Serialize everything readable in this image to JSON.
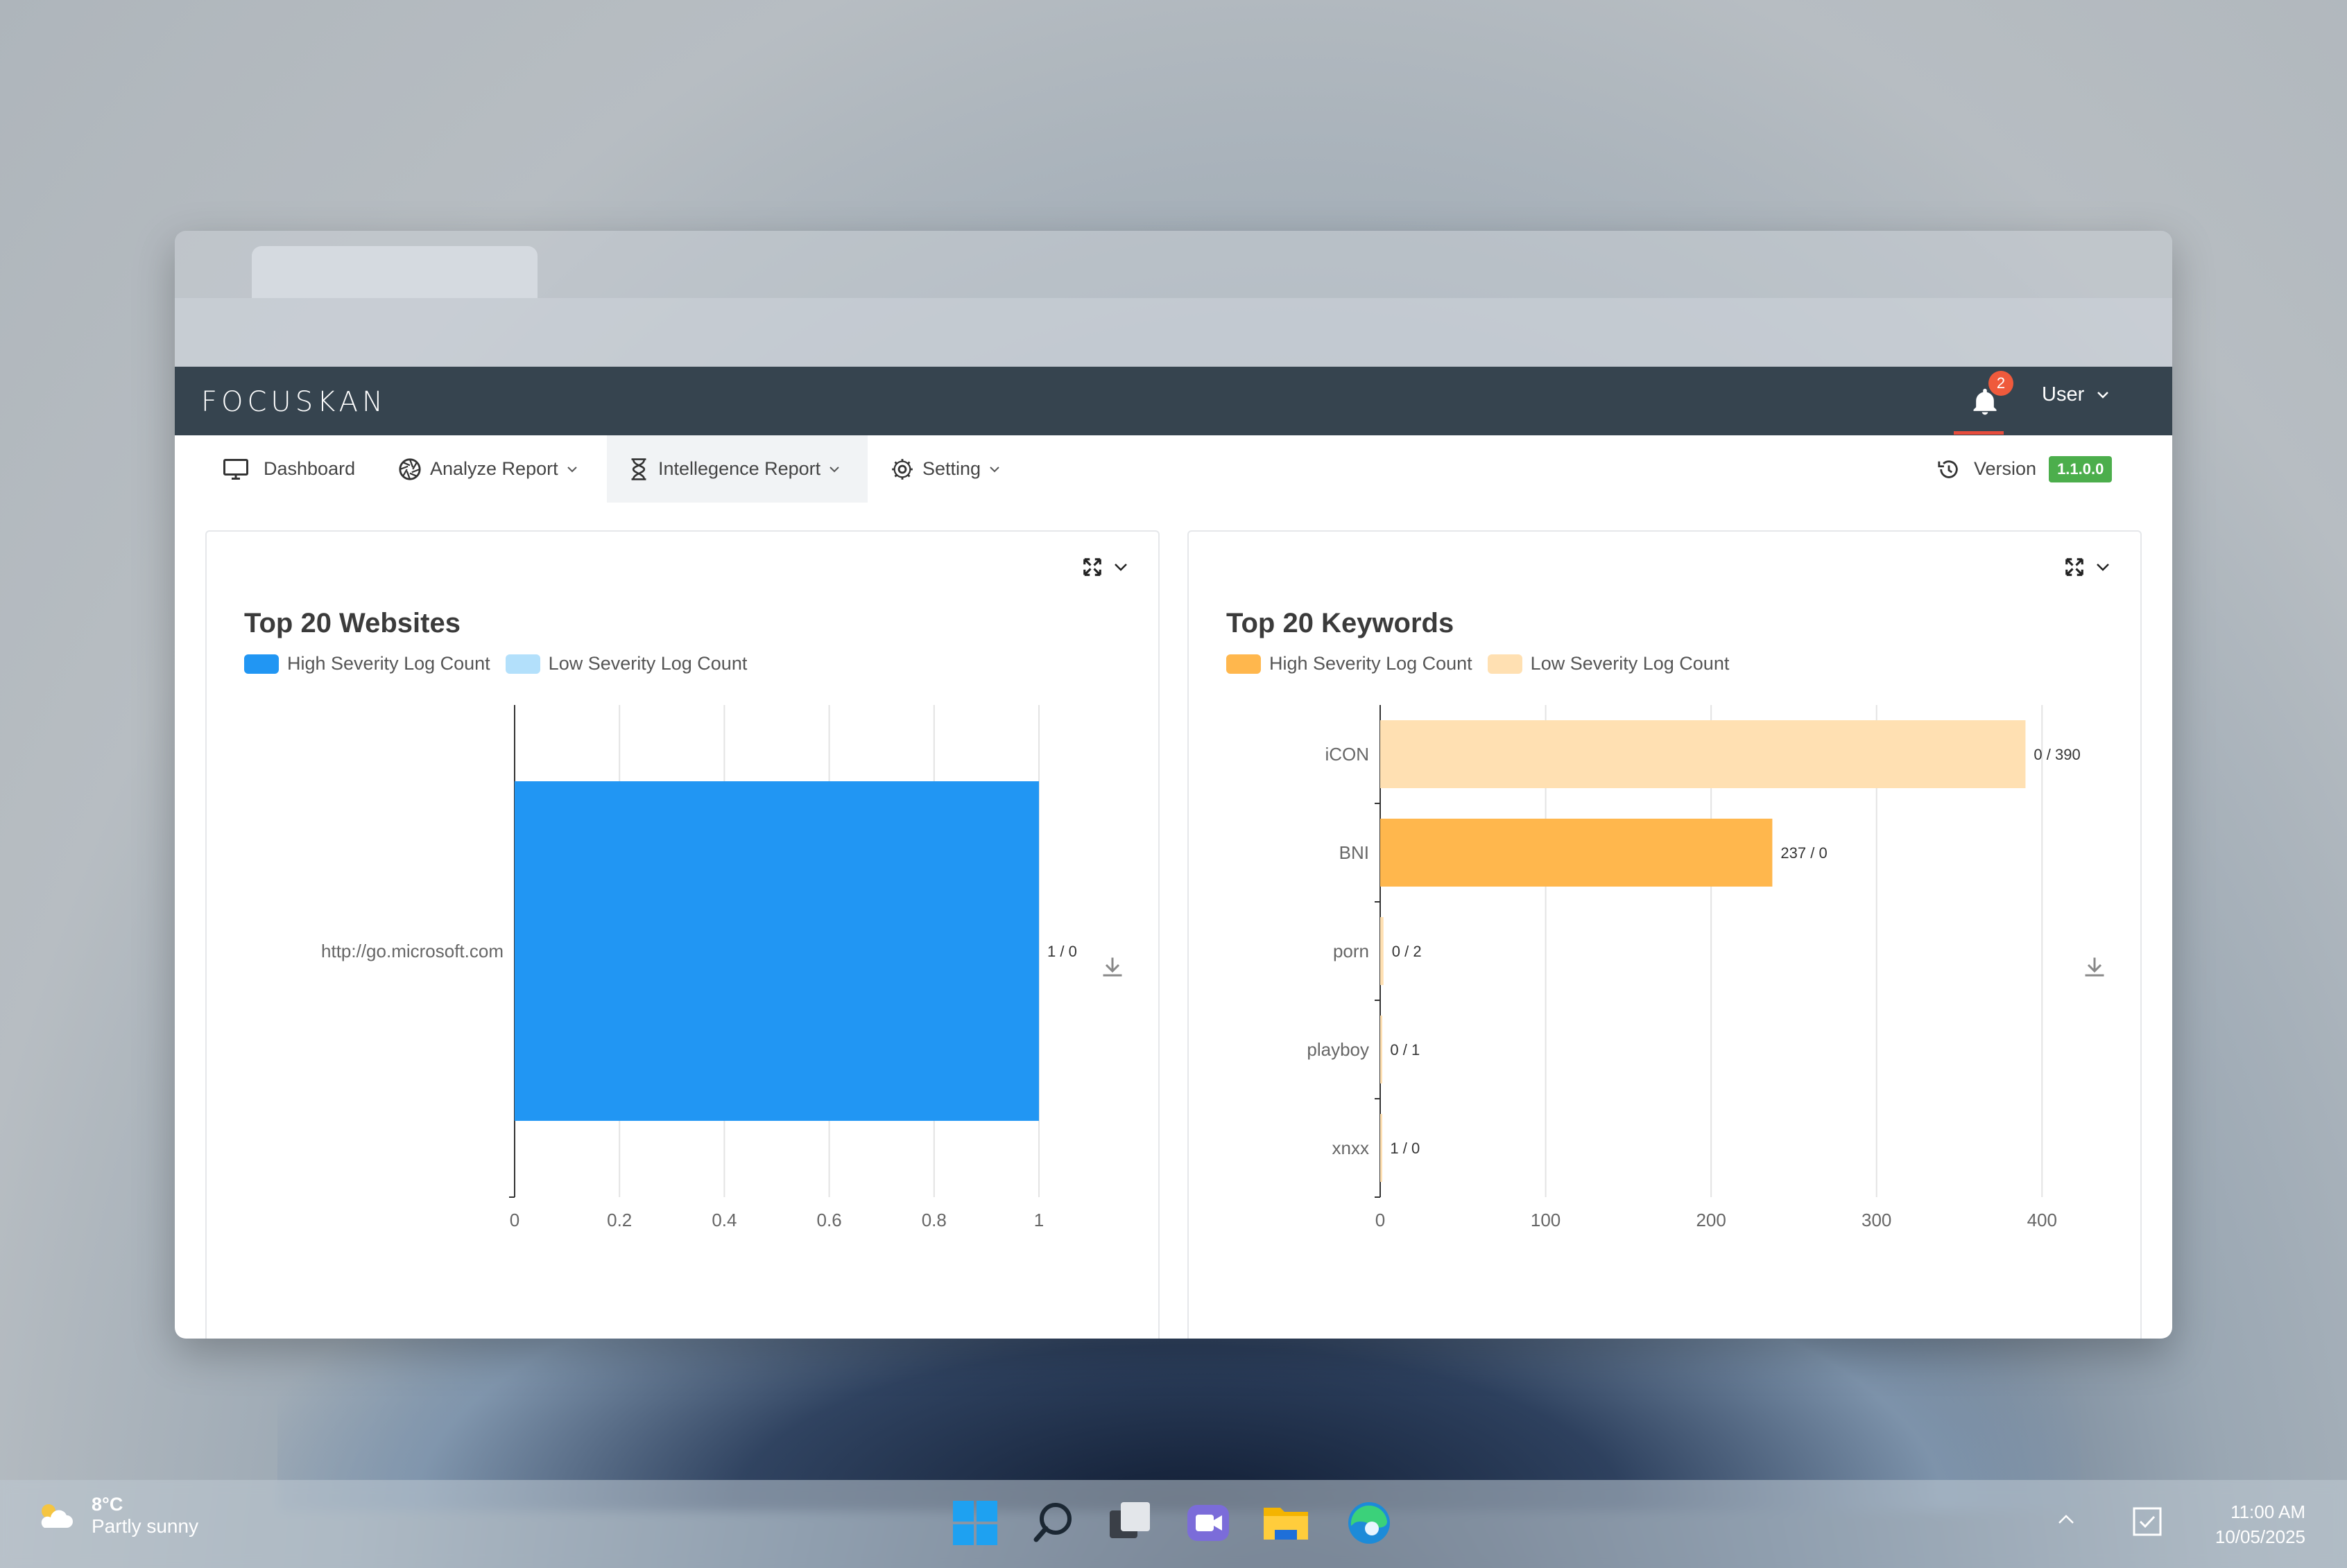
{
  "app": {
    "logo": "FOCUSKAN",
    "notifications_count": "2",
    "user_label": "User"
  },
  "nav": {
    "items": [
      {
        "label": "Dashboard",
        "icon": "monitor-icon"
      },
      {
        "label": "Analyze Report",
        "icon": "aperture-icon"
      },
      {
        "label": "Intellegence Report",
        "icon": "hourglass-icon"
      },
      {
        "label": "Setting",
        "icon": "gear-icon"
      }
    ],
    "active": "Intellegence Report",
    "version_label": "Version",
    "version_value": "1.1.0.0"
  },
  "panels": {
    "websites": {
      "title": "Top 20 Websites",
      "legend": [
        "High Severity Log Count",
        "Low Severity Log Count"
      ]
    },
    "keywords": {
      "title": "Top 20 Keywords",
      "legend": [
        "High Severity Log Count",
        "Low Severity Log Count"
      ]
    }
  },
  "chart_data": [
    {
      "type": "bar",
      "orientation": "horizontal",
      "stacked": true,
      "title": "Top 20 Websites",
      "categories": [
        "http://go.microsoft.com"
      ],
      "series": [
        {
          "name": "High Severity Log Count",
          "values": [
            1
          ],
          "color": "#2196f3"
        },
        {
          "name": "Low Severity Log Count",
          "values": [
            0
          ],
          "color": "#b3e0fb"
        }
      ],
      "data_labels": [
        "1 / 0"
      ],
      "xlim": [
        0,
        1
      ],
      "x_ticks": [
        "0",
        "0.2",
        "0.4",
        "0.6",
        "0.8",
        "1"
      ],
      "grid": true,
      "legend_position": "top-left"
    },
    {
      "type": "bar",
      "orientation": "horizontal",
      "stacked": true,
      "title": "Top 20 Keywords",
      "categories": [
        "iCON",
        "BNI",
        "porn",
        "playboy",
        "xnxx"
      ],
      "series": [
        {
          "name": "High Severity Log Count",
          "values": [
            0,
            237,
            0,
            0,
            1
          ],
          "color": "#ffb74d"
        },
        {
          "name": "Low Severity Log Count",
          "values": [
            390,
            0,
            2,
            1,
            0
          ],
          "color": "#ffe0b2"
        }
      ],
      "data_labels": [
        "0 / 390",
        "237 / 0",
        "0 / 2",
        "0 / 1",
        "1 / 0"
      ],
      "xlim": [
        0,
        420
      ],
      "x_ticks": [
        "0",
        "100",
        "200",
        "300",
        "400"
      ],
      "grid": true,
      "legend_position": "top-left"
    }
  ],
  "taskbar": {
    "temperature": "8°C",
    "weather": "Partly sunny",
    "time": "11:00 AM",
    "date": "10/05/2025",
    "icons": [
      "windows-start-icon",
      "search-icon",
      "task-view-icon",
      "teams-icon",
      "file-explorer-icon",
      "edge-icon"
    ]
  }
}
